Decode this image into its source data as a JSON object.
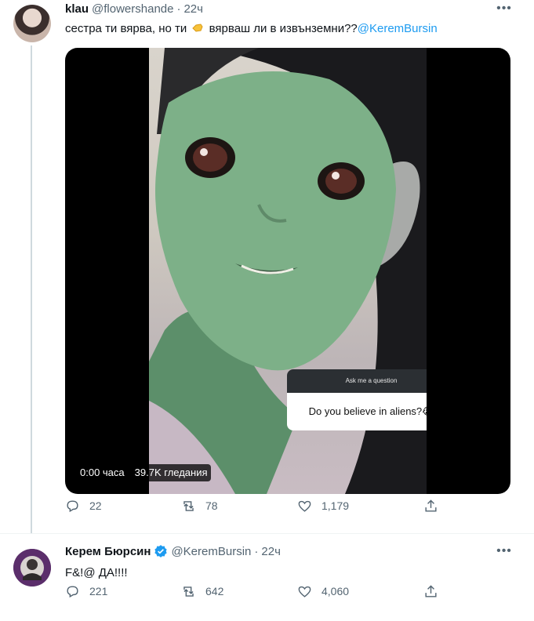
{
  "tweets": [
    {
      "display_name": "klau",
      "handle": "@flowershande",
      "separator": "·",
      "time": "22ч",
      "text_before": "сестра ти вярва, но ти",
      "text_after": "вярваш ли в извънземни??",
      "mention": "@KeremBursin",
      "more_icon": "more-dots-icon",
      "media": {
        "sticker_header": "Ask me a question",
        "sticker_question": "Do you believe in aliens?😭",
        "video_time": "0:00 часа",
        "video_views": "39.7K гледания"
      },
      "actions": {
        "replies": "22",
        "retweets": "78",
        "likes": "1,179"
      }
    },
    {
      "display_name": "Керем Бюрсин",
      "handle": "@KeremBursin",
      "separator": "·",
      "time": "22ч",
      "text": "F&!@ ДА!!!!",
      "verified_color": "#1d9bf0",
      "actions": {
        "replies": "221",
        "retweets": "642",
        "likes": "4,060"
      }
    }
  ],
  "colors": {
    "accent": "#1d9bf0",
    "muted": "#536471",
    "text": "#0f1419"
  }
}
